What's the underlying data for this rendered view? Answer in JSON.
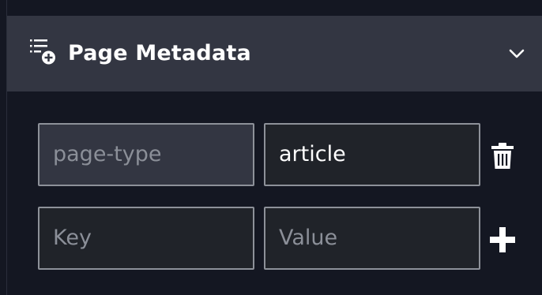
{
  "panel": {
    "title": "Page Metadata",
    "header_icon": "list-add-icon",
    "collapse_icon": "chevron-down-icon"
  },
  "rows": [
    {
      "key": "page-type",
      "value": "article",
      "action_icon": "trash-icon"
    }
  ],
  "new_row": {
    "key_placeholder": "Key",
    "value_placeholder": "Value",
    "action_icon": "plus-icon"
  },
  "colors": {
    "background": "#141722",
    "header": "#333642",
    "input": "#202329",
    "border": "#8d9199",
    "placeholder": "#8b8f98",
    "text": "#ffffff"
  }
}
